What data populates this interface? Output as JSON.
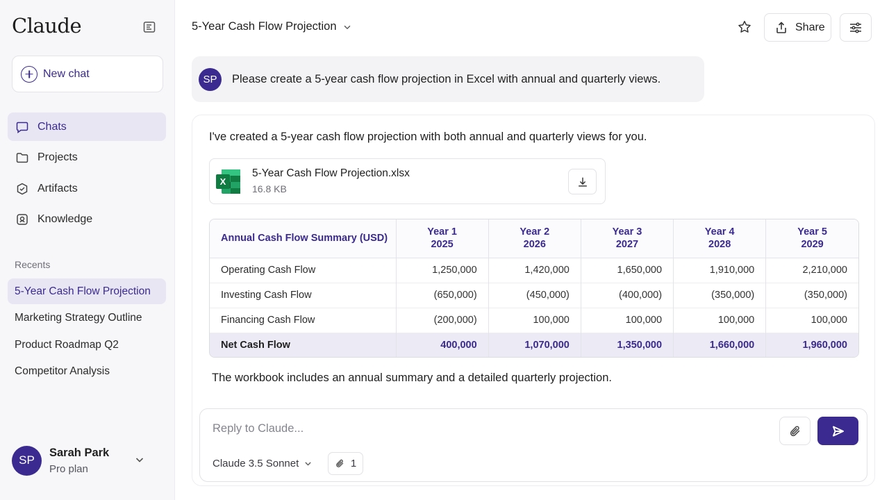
{
  "sidebar": {
    "logo": "Claude",
    "new_chat_label": "New chat",
    "nav": [
      {
        "label": "Chats",
        "icon": "chat-bubble-icon",
        "active": true
      },
      {
        "label": "Projects",
        "icon": "folder-icon"
      },
      {
        "label": "Artifacts",
        "icon": "artifacts-icon"
      },
      {
        "label": "Knowledge",
        "icon": "knowledge-icon"
      }
    ],
    "recents_title": "Recents",
    "recents": [
      {
        "label": "5-Year Cash Flow Projection",
        "active": true
      },
      {
        "label": "Marketing Strategy Outline"
      },
      {
        "label": "Product Roadmap Q2"
      },
      {
        "label": "Competitor Analysis"
      }
    ],
    "user": {
      "initials": "SP",
      "name": "Sarah Park",
      "plan": "Pro plan"
    }
  },
  "header": {
    "title": "5-Year Cash Flow Projection",
    "share_label": "Share"
  },
  "user_message": {
    "initials": "SP",
    "text": "Please create a 5-year cash flow projection in Excel with annual and quarterly views."
  },
  "assistant": {
    "intro": "I've created a 5-year cash flow projection with both annual and quarterly views for you.",
    "file": {
      "name": "5-Year Cash Flow Projection.xlsx",
      "size": "16.8 KB"
    },
    "table": {
      "header_label": "Annual Cash Flow Summary (USD)",
      "columns": [
        {
          "year": "Year 1",
          "date": "2025"
        },
        {
          "year": "Year 2",
          "date": "2026"
        },
        {
          "year": "Year 3",
          "date": "2027"
        },
        {
          "year": "Year 4",
          "date": "2028"
        },
        {
          "year": "Year 5",
          "date": "2029"
        }
      ],
      "rows": [
        {
          "label": "Operating Cash Flow",
          "values": [
            "1,250,000",
            "1,420,000",
            "1,650,000",
            "1,910,000",
            "2,210,000"
          ]
        },
        {
          "label": "Investing Cash Flow",
          "values": [
            "(650,000)",
            "(450,000)",
            "(400,000)",
            "(350,000)",
            "(350,000)"
          ]
        },
        {
          "label": "Financing Cash Flow",
          "values": [
            "(200,000)",
            "100,000",
            "100,000",
            "100,000",
            "100,000"
          ]
        },
        {
          "label": "Net Cash Flow",
          "values": [
            "400,000",
            "1,070,000",
            "1,350,000",
            "1,660,000",
            "1,960,000"
          ]
        }
      ]
    },
    "outro": "The workbook includes an annual summary and a detailed quarterly projection."
  },
  "composer": {
    "placeholder": "Reply to Claude...",
    "model": "Claude 3.5 Sonnet",
    "attachment_count": "1"
  },
  "colors": {
    "accent": "#3b2a8f",
    "excel_green": "#1e7b45"
  }
}
